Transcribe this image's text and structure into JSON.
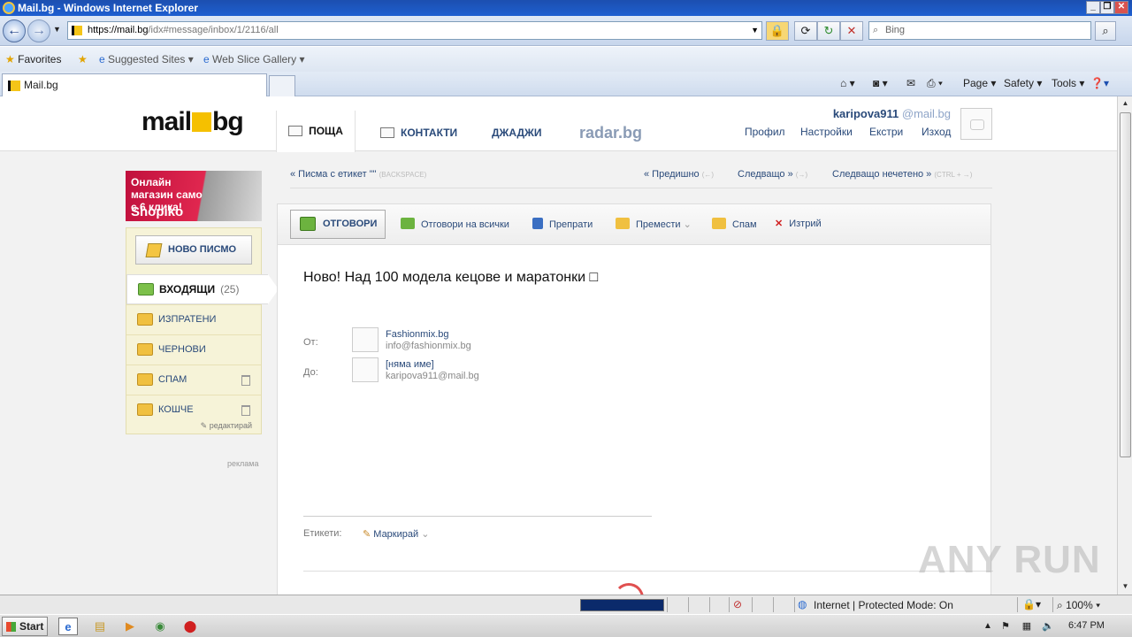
{
  "browser": {
    "title": "Mail.bg - Windows Internet Explorer",
    "url_main": "https://mail.bg",
    "url_rest": "/idx#message/inbox/1/2116/all",
    "search_placeholder": "Bing",
    "favorites_label": "Favorites",
    "suggested_sites": "Suggested Sites",
    "web_slice_gallery": "Web Slice Gallery",
    "tab_title": "Mail.bg",
    "cmd_page": "Page",
    "cmd_safety": "Safety",
    "cmd_tools": "Tools"
  },
  "header": {
    "logo_left": "mail",
    "logo_right": "bg",
    "nav": {
      "mail": "ПОЩА",
      "contacts": "КОНТАКТИ",
      "gadgets": "ДЖАДЖИ",
      "radar": "radar.bg"
    },
    "user": "karipova911",
    "user_domain": "@mail.bg",
    "links": {
      "profile": "Профил",
      "settings": "Настройки",
      "extras": "Екстри",
      "logout": "Изход"
    }
  },
  "ad": {
    "line1": "Онлайн магазин само с 6 клика!",
    "line2": "Shopiko"
  },
  "sidebar": {
    "compose": "НОВО ПИСМО",
    "folders": [
      {
        "label": "ВХОДЯЩИ",
        "count": "(25)"
      },
      {
        "label": "ИЗПРАТЕНИ"
      },
      {
        "label": "ЧЕРНОВИ"
      },
      {
        "label": "СПАМ"
      },
      {
        "label": "КОШЧЕ"
      }
    ],
    "edit": "редактирай",
    "ad_label": "реклама"
  },
  "crumbs": {
    "back": "« Писма с етикет \"\"",
    "back_hint": "(BACKSPACE)",
    "prev": "« Предишно",
    "prev_hint": "(←)",
    "next": "Следващо »",
    "next_hint": "(→)",
    "next_unread": "Следващо нечетено »",
    "next_unread_hint": "(CTRL + →)"
  },
  "toolbar": {
    "reply": "ОТГОВОРИ",
    "reply_all": "Отговори на всички",
    "forward": "Препрати",
    "move": "Премести",
    "spam": "Спам",
    "delete": "Изтрий"
  },
  "message": {
    "subject": "Ново! Над 100 модела кецове и маратонки □",
    "from_label": "От:",
    "from_name": "Fashionmix.bg",
    "from_email": "info@fashionmix.bg",
    "to_label": "До:",
    "to_name": "[няма име]",
    "to_email": "karipova911@mail.bg",
    "tags_label": "Етикети:",
    "mark": "Маркирай"
  },
  "statusbar": {
    "zone": "Internet | Protected Mode: On",
    "zoom": "100%"
  },
  "taskbar": {
    "start": "Start",
    "clock": "6:47 PM"
  },
  "watermark": "ANY RUN",
  "colors": {
    "link": "#2a4a7a",
    "logo_accent": "#f5c000",
    "sidebar_bg": "#f6f3d8"
  }
}
